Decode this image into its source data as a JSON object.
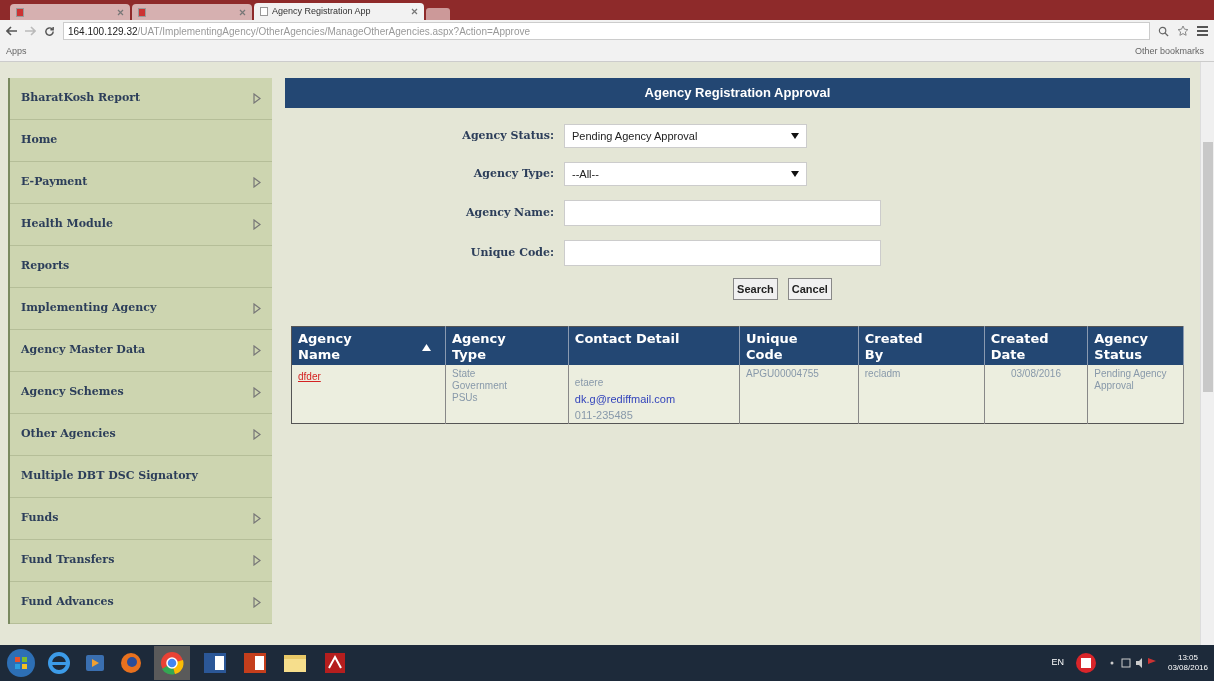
{
  "browser": {
    "tabs": [
      {
        "selected": false
      },
      {
        "selected": false
      },
      {
        "title": "Agency Registration App",
        "selected": true
      }
    ],
    "url": {
      "host": "164.100.129.32",
      "path": "/UAT/ImplementingAgency/OtherAgencies/ManageOtherAgencies.aspx?Action=Approve"
    },
    "bookmarks": [
      "Apps",
      "Other bookmarks"
    ]
  },
  "sidebar": {
    "items": [
      {
        "label": "BharatKosh Report",
        "has_submenu": true
      },
      {
        "label": "Home",
        "has_submenu": false
      },
      {
        "label": "E-Payment",
        "has_submenu": true
      },
      {
        "label": "Health Module",
        "has_submenu": true
      },
      {
        "label": "Reports",
        "has_submenu": false
      },
      {
        "label": "Implementing Agency",
        "has_submenu": true
      },
      {
        "label": "Agency Master Data",
        "has_submenu": true
      },
      {
        "label": "Agency Schemes",
        "has_submenu": true
      },
      {
        "label": "Other Agencies",
        "has_submenu": true
      },
      {
        "label": "Multiple DBT DSC Signatory",
        "has_submenu": false
      },
      {
        "label": "Funds",
        "has_submenu": true
      },
      {
        "label": "Fund Transfers",
        "has_submenu": true
      },
      {
        "label": "Fund Advances",
        "has_submenu": true
      }
    ]
  },
  "panel": {
    "title": "Agency Registration Approval",
    "fields": [
      {
        "kind": "select",
        "label": "Agency Status:",
        "value": "Pending Agency Approval"
      },
      {
        "kind": "select",
        "label": "Agency Type:",
        "value": "--All--"
      },
      {
        "kind": "text",
        "label": "Agency Name:"
      },
      {
        "kind": "text",
        "label": "Unique Code:"
      }
    ],
    "buttons": [
      "Search",
      "Cancel"
    ]
  },
  "table": {
    "columns": [
      {
        "label": "Agency Name",
        "sorted": true
      },
      {
        "label": "Agency Type",
        "sorted": false
      },
      {
        "label": "Contact Detail",
        "sorted": false
      },
      {
        "label": "Unique Code",
        "sorted": false
      },
      {
        "label": "Created By",
        "sorted": false
      },
      {
        "label": "Created Date",
        "sorted": false
      },
      {
        "label": "Agency Status",
        "sorted": false
      }
    ],
    "rows": [
      {
        "agency_name": "dfder",
        "agency_type": "State Government PSUs",
        "contact": [
          "etaere",
          "dk.g@rediffmail.com",
          "011-235485"
        ],
        "unique_code": "APGU00004755",
        "created_by": "recladm",
        "created_date": "03/08/2016",
        "status": "Pending Agency Approval"
      }
    ]
  },
  "taskbar": {
    "language": "EN",
    "time": "13:05",
    "date": "03/08/2016"
  }
}
